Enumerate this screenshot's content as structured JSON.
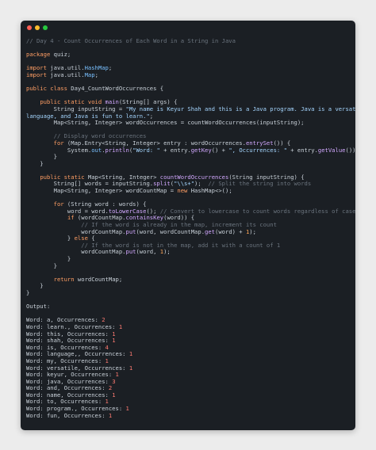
{
  "window": {
    "buttons": [
      "close",
      "minimize",
      "maximize"
    ]
  },
  "code_lines": [
    [
      [
        "cmt",
        "// Day 4 - Count Occurrences of Each Word in a String in Java"
      ]
    ],
    [],
    [
      [
        "kw",
        "package"
      ],
      [
        "t",
        " quiz;"
      ]
    ],
    [],
    [
      [
        "kw",
        "import"
      ],
      [
        "t",
        " java.util."
      ],
      [
        "ty",
        "HashMap"
      ],
      [
        "t",
        ";"
      ]
    ],
    [
      [
        "kw",
        "import"
      ],
      [
        "t",
        " java.util."
      ],
      [
        "ty",
        "Map"
      ],
      [
        "t",
        ";"
      ]
    ],
    [],
    [
      [
        "kw",
        "public class"
      ],
      [
        "t",
        " Day4_CountWordOccurrences {"
      ]
    ],
    [],
    [
      [
        "t",
        "    "
      ],
      [
        "kw",
        "public static void"
      ],
      [
        "t",
        " "
      ],
      [
        "fn",
        "main"
      ],
      [
        "t",
        "(String[] args) {"
      ]
    ],
    [
      [
        "t",
        "        String inputString = "
      ],
      [
        "str",
        "\"My name is Keyur Shah and this is a Java program. Java is a versatile"
      ]
    ],
    [
      [
        "str",
        "language, and Java is fun to learn.\""
      ],
      [
        "t",
        ";"
      ]
    ],
    [
      [
        "t",
        "        Map<String, Integer> wordOccurrences = countWordOccurrences(inputString);"
      ]
    ],
    [],
    [
      [
        "t",
        "        "
      ],
      [
        "cmt",
        "// Display word occurrences"
      ]
    ],
    [
      [
        "t",
        "        "
      ],
      [
        "kw",
        "for"
      ],
      [
        "t",
        " (Map.Entry<String, Integer> entry : wordOccurrences."
      ],
      [
        "fn",
        "entrySet"
      ],
      [
        "t",
        "()) {"
      ]
    ],
    [
      [
        "t",
        "            System."
      ],
      [
        "ty",
        "out"
      ],
      [
        "t",
        "."
      ],
      [
        "fn",
        "println"
      ],
      [
        "t",
        "("
      ],
      [
        "str",
        "\"Word: \""
      ],
      [
        "t",
        " + entry."
      ],
      [
        "fn",
        "getKey"
      ],
      [
        "t",
        "() + "
      ],
      [
        "str",
        "\", Occurrences: \""
      ],
      [
        "t",
        " + entry."
      ],
      [
        "fn",
        "getValue"
      ],
      [
        "t",
        "());"
      ]
    ],
    [
      [
        "t",
        "        }"
      ]
    ],
    [
      [
        "t",
        "    }"
      ]
    ],
    [],
    [
      [
        "t",
        "    "
      ],
      [
        "kw",
        "public static"
      ],
      [
        "t",
        " Map<String, Integer> "
      ],
      [
        "fn",
        "countWordOccurrences"
      ],
      [
        "t",
        "(String inputString) {"
      ]
    ],
    [
      [
        "t",
        "        String[] words = inputString."
      ],
      [
        "fn",
        "split"
      ],
      [
        "t",
        "("
      ],
      [
        "str",
        "\"\\\\s+\""
      ],
      [
        "t",
        ");  "
      ],
      [
        "cmt",
        "// Split the string into words"
      ]
    ],
    [
      [
        "t",
        "        Map<String, Integer> wordCountMap = "
      ],
      [
        "kw",
        "new"
      ],
      [
        "t",
        " HashMap<>();"
      ]
    ],
    [],
    [
      [
        "t",
        "        "
      ],
      [
        "kw",
        "for"
      ],
      [
        "t",
        " (String word : words) {"
      ]
    ],
    [
      [
        "t",
        "            word = word."
      ],
      [
        "fn",
        "toLowerCase"
      ],
      [
        "t",
        "(); "
      ],
      [
        "cmt",
        "// Convert to lowercase to count words regardless of case"
      ]
    ],
    [
      [
        "t",
        "            "
      ],
      [
        "kw",
        "if"
      ],
      [
        "t",
        " (wordCountMap."
      ],
      [
        "fn",
        "containsKey"
      ],
      [
        "t",
        "(word)) {"
      ]
    ],
    [
      [
        "t",
        "                "
      ],
      [
        "cmt",
        "// If the word is already in the map, increment its count"
      ]
    ],
    [
      [
        "t",
        "                wordCountMap."
      ],
      [
        "fn",
        "put"
      ],
      [
        "t",
        "(word, wordCountMap."
      ],
      [
        "fn",
        "get"
      ],
      [
        "t",
        "(word) + "
      ],
      [
        "num",
        "1"
      ],
      [
        "t",
        ");"
      ]
    ],
    [
      [
        "t",
        "            } "
      ],
      [
        "kw",
        "else"
      ],
      [
        "t",
        " {"
      ]
    ],
    [
      [
        "t",
        "                "
      ],
      [
        "cmt",
        "// If the word is not in the map, add it with a count of 1"
      ]
    ],
    [
      [
        "t",
        "                wordCountMap."
      ],
      [
        "fn",
        "put"
      ],
      [
        "t",
        "(word, "
      ],
      [
        "num",
        "1"
      ],
      [
        "t",
        ");"
      ]
    ],
    [
      [
        "t",
        "            }"
      ]
    ],
    [
      [
        "t",
        "        }"
      ]
    ],
    [],
    [
      [
        "t",
        "        "
      ],
      [
        "kw",
        "return"
      ],
      [
        "t",
        " wordCountMap;"
      ]
    ],
    [
      [
        "t",
        "    }"
      ]
    ],
    [
      [
        "t",
        "}"
      ]
    ],
    [],
    [
      [
        "t",
        "Output:"
      ]
    ],
    [],
    [
      [
        "t",
        "Word: a, Occurrences: "
      ],
      [
        "out",
        "2"
      ]
    ],
    [
      [
        "t",
        "Word: learn., Occurrences: "
      ],
      [
        "out",
        "1"
      ]
    ],
    [
      [
        "t",
        "Word: this, Occurrences: "
      ],
      [
        "out",
        "1"
      ]
    ],
    [
      [
        "t",
        "Word: shah, Occurrences: "
      ],
      [
        "out",
        "1"
      ]
    ],
    [
      [
        "t",
        "Word: is, Occurrences: "
      ],
      [
        "out",
        "4"
      ]
    ],
    [
      [
        "t",
        "Word: language,, Occurrences: "
      ],
      [
        "out",
        "1"
      ]
    ],
    [
      [
        "t",
        "Word: my, Occurrences: "
      ],
      [
        "out",
        "1"
      ]
    ],
    [
      [
        "t",
        "Word: versatile, Occurrences: "
      ],
      [
        "out",
        "1"
      ]
    ],
    [
      [
        "t",
        "Word: keyur, Occurrences: "
      ],
      [
        "out",
        "1"
      ]
    ],
    [
      [
        "t",
        "Word: java, Occurrences: "
      ],
      [
        "out",
        "3"
      ]
    ],
    [
      [
        "t",
        "Word: and, Occurrences: "
      ],
      [
        "out",
        "2"
      ]
    ],
    [
      [
        "t",
        "Word: name, Occurrences: "
      ],
      [
        "out",
        "1"
      ]
    ],
    [
      [
        "t",
        "Word: to, Occurrences: "
      ],
      [
        "out",
        "1"
      ]
    ],
    [
      [
        "t",
        "Word: program., Occurrences: "
      ],
      [
        "out",
        "1"
      ]
    ],
    [
      [
        "t",
        "Word: fun, Occurrences: "
      ],
      [
        "out",
        "1"
      ]
    ]
  ]
}
